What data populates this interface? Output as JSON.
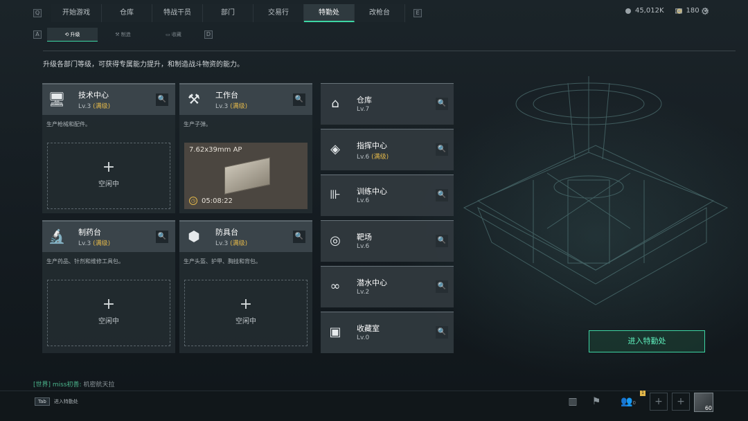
{
  "topnav": {
    "key_left": "Q",
    "key_right": "E",
    "tabs": [
      "开始游戏",
      "仓库",
      "特战干员",
      "部门",
      "交易行",
      "特勤处",
      "改枪台"
    ],
    "active_tab": "特勤处"
  },
  "currency": {
    "silver": "45,012K",
    "gold": "180",
    "gold_add": "+"
  },
  "subnav": {
    "key_left": "A",
    "key_right": "D",
    "tabs": [
      "升级",
      "制造",
      "收藏"
    ],
    "active_tab": "升级"
  },
  "description": "升级各部门等级，可获得专属能力提升，和制造战斗物资的能力。",
  "workshops": [
    {
      "name": "技术中心",
      "level": "Lv.3",
      "max": "(满级)",
      "sub": "生产枪械和配件。",
      "icon": "computer-icon",
      "state": "idle"
    },
    {
      "name": "工作台",
      "level": "Lv.3",
      "max": "(满级)",
      "sub": "生产子弹。",
      "icon": "tools-icon",
      "state": "producing"
    },
    {
      "name": "制药台",
      "level": "Lv.3",
      "max": "(满级)",
      "sub": "生产药品、针剂和维修工具包。",
      "icon": "microscope-icon",
      "state": "idle"
    },
    {
      "name": "防具台",
      "level": "Lv.3",
      "max": "(满级)",
      "sub": "生产头盔、护甲、胸挂和背包。",
      "icon": "armor-icon",
      "state": "idle"
    }
  ],
  "production": {
    "item": "7.62x39mm AP",
    "time": "05:08:22"
  },
  "idle": {
    "plus": "+",
    "label": "空闲中"
  },
  "facilities": [
    {
      "name": "仓库",
      "level": "Lv.7",
      "max": "",
      "icon": "warehouse-icon"
    },
    {
      "name": "指挥中心",
      "level": "Lv.6",
      "max": "(满级)",
      "icon": "command-icon"
    },
    {
      "name": "训练中心",
      "level": "Lv.6",
      "max": "",
      "icon": "dumbbell-icon"
    },
    {
      "name": "靶场",
      "level": "Lv.6",
      "max": "",
      "icon": "target-icon"
    },
    {
      "name": "潜水中心",
      "level": "Lv.2",
      "max": "",
      "icon": "goggles-icon"
    },
    {
      "name": "收藏室",
      "level": "Lv.0",
      "max": "",
      "icon": "collection-icon"
    }
  ],
  "enter_button": "进入特勤处",
  "chat": {
    "channel": "[世界]",
    "user": "miss初善:",
    "message": "机密航天拉"
  },
  "tab_hint": {
    "key": "Tab",
    "label": "进入特勤处"
  },
  "bottom": {
    "friends_count": "0",
    "badge": "1",
    "avatar_level": "60"
  },
  "colors": {
    "accent": "#3ed6a4",
    "max_level": "#e3b84a"
  }
}
